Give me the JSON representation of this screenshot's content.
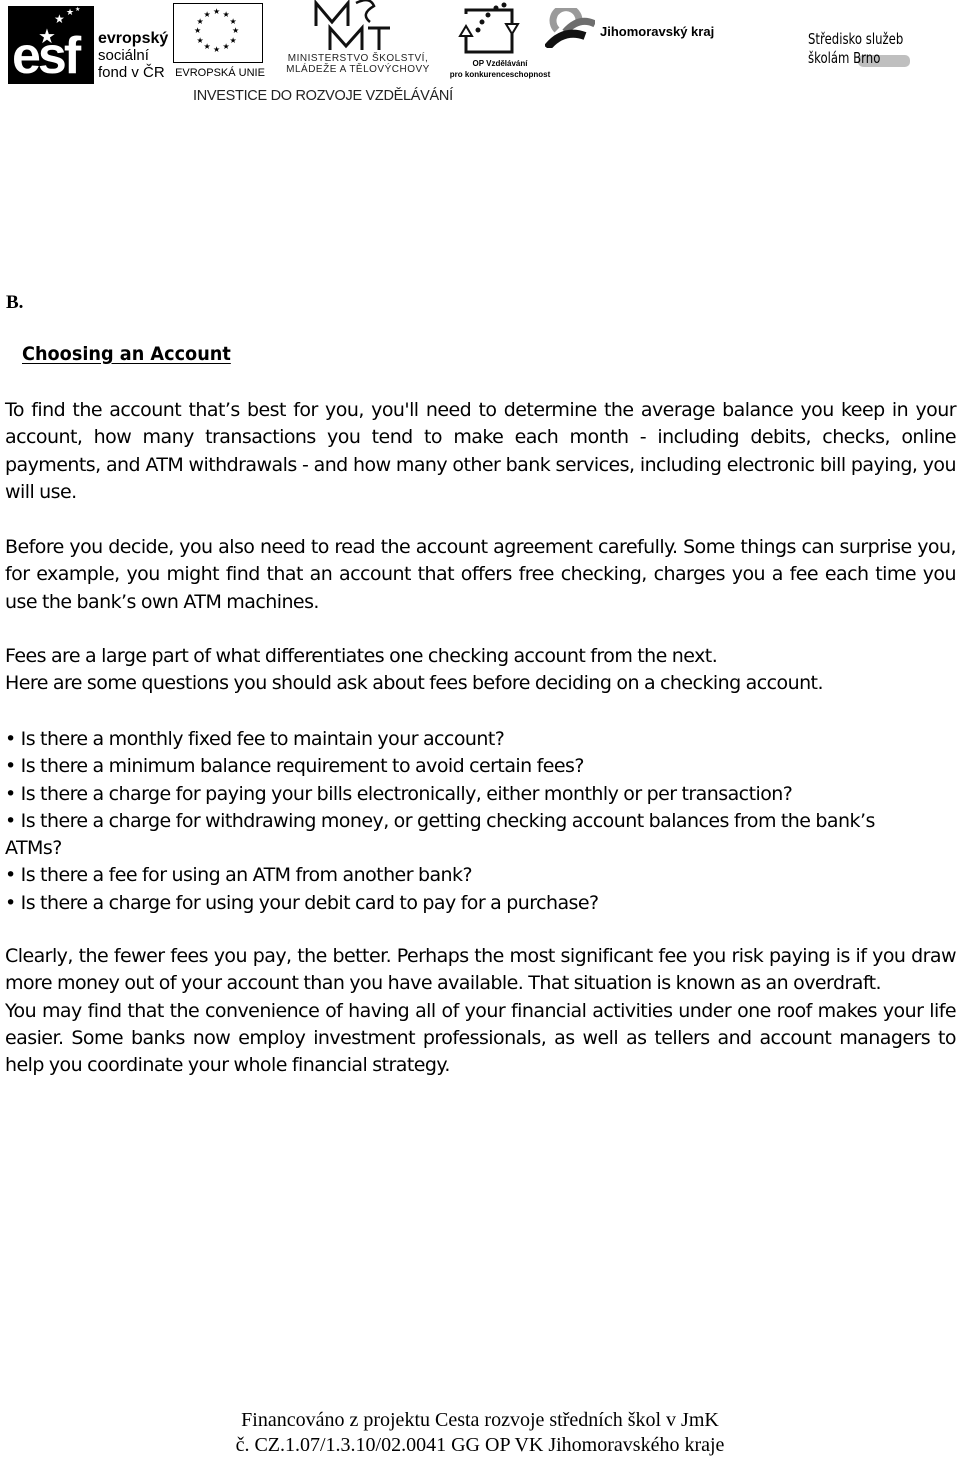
{
  "header": {
    "esf": {
      "mark": "esf",
      "lines": [
        "evropský",
        "sociální",
        "fond v ČR"
      ]
    },
    "eu": {
      "label": "EVROPSKÁ UNIE"
    },
    "msmt": {
      "mark": "MŠMT",
      "lines": [
        "MINISTERSTVO ŠKOLSTVÍ,",
        "MLÁDEŽE A TĚLOVÝCHOVY"
      ]
    },
    "op": {
      "lines": [
        "OP Vzdělávání",
        "pro konkurenceschopnost"
      ]
    },
    "jmk": {
      "label": "Jihomoravský kraj"
    },
    "ssb": {
      "lines": [
        "Středisko služeb",
        "školám Brno"
      ]
    },
    "tagline": "INVESTICE DO ROZVOJE VZDĚLÁVÁNÍ"
  },
  "document": {
    "section_letter": "B.",
    "title": "Choosing an Account",
    "paragraphs": [
      "To find the account that’s best for you, you'll need to determine the average balance you keep in your account, how many transactions you tend to make each month - including debits, checks, online payments, and ATM withdrawals - and how many other bank services, including electronic bill paying, you will use.",
      "Before you decide, you also need to read the account agreement carefully. Some things can surprise you, for example, you might find that an account that offers free checking,  charges you a fee each time you use the bank’s own ATM machines.",
      "Fees are a large part of what differentiates one checking account from the next.",
      "Here are some questions you should ask about fees before deciding on a checking account."
    ],
    "bullets": [
      "Is there a monthly fixed fee to maintain your account?",
      "Is there a minimum balance requirement to avoid certain fees?",
      "Is there a charge for paying your bills electronically, either monthly or per transaction?",
      "Is there a charge for withdrawing money, or getting checking account balances from the bank’s ATMs?",
      "Is there a fee for using an ATM from another bank?",
      "Is there a charge for using your debit card to pay for a purchase?"
    ],
    "closing": [
      "Clearly, the fewer fees you pay, the better. Perhaps the most significant fee you risk paying is if you draw more money out of your account than you have available. That situation is known as an overdraft.",
      "You may find that the convenience of having all of your financial activities under one roof makes your life easier. Some banks now employ investment professionals, as well as tellers and account managers to help you coordinate your whole financial strategy."
    ]
  },
  "footer": {
    "lines": [
      "Financováno z projektu Cesta rozvoje středních škol v JmK",
      "č. CZ.1.07/1.3.10/02.0041 GG OP VK Jihomoravského kraje"
    ]
  }
}
